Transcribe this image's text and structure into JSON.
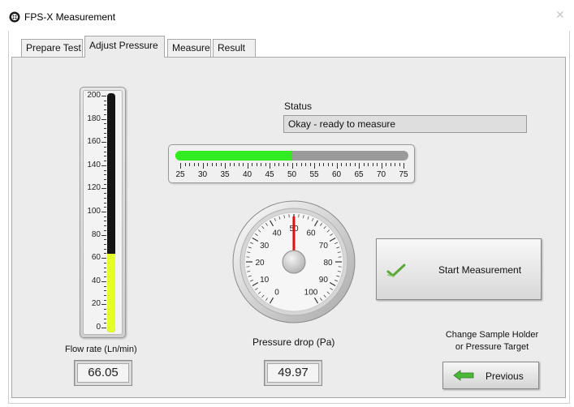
{
  "window": {
    "title": "FPS-X Measurement",
    "close_glyph": "✕",
    "icon": "app-logo-icon"
  },
  "tabs": [
    {
      "label": "Prepare Test",
      "active": false
    },
    {
      "label": "Adjust Pressure",
      "active": true
    },
    {
      "label": "Measure",
      "active": false
    },
    {
      "label": "Result",
      "active": false
    }
  ],
  "flow_gauge": {
    "label": "Flow rate (Ln/min)",
    "value": "66.05",
    "scale_min": 0,
    "scale_max": 200,
    "ticks": [
      "200",
      "180",
      "160",
      "140",
      "120",
      "100",
      "80",
      "60",
      "40",
      "20",
      "0"
    ],
    "fill_color": "#e4ff28"
  },
  "status": {
    "label": "Status",
    "value": "Okay - ready to measure"
  },
  "pressure_bar": {
    "scale_min": 25,
    "scale_max": 75,
    "value": 49.97,
    "ticks": [
      "25",
      "30",
      "35",
      "40",
      "45",
      "50",
      "55",
      "60",
      "65",
      "70",
      "75"
    ],
    "fill_color": "#31ec1e"
  },
  "dial": {
    "label": "Pressure drop (Pa)",
    "value": "49.97",
    "scale_min": 0,
    "scale_max": 100,
    "ticks": [
      "0",
      "10",
      "20",
      "30",
      "40",
      "50",
      "60",
      "70",
      "80",
      "90",
      "100"
    ],
    "needle_color": "#e01010"
  },
  "start_button": {
    "label": "Start Measurement",
    "icon": "checkmark-icon"
  },
  "previous_section": {
    "caption_line1": "Change Sample Holder",
    "caption_line2": "or Pressure Target",
    "button_label": "Previous",
    "icon": "arrow-left-icon"
  }
}
